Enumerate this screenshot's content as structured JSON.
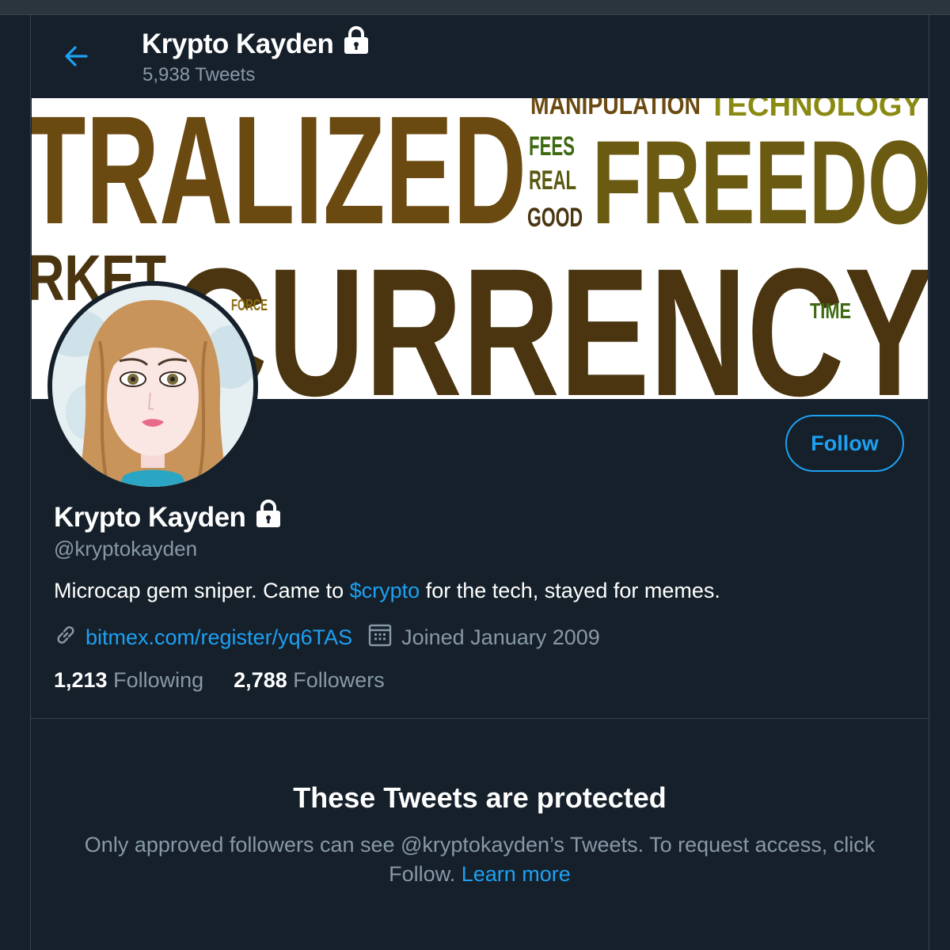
{
  "header": {
    "name": "Krypto Kayden",
    "tweet_count": "5,938 Tweets"
  },
  "banner": {
    "words": [
      "TRALIZED",
      "MANIPULATION",
      "TECHNOLOGY",
      "FEES",
      "REAL",
      "GOOD",
      "FREEDO",
      "RKET",
      "CURRENCY",
      "FORCE",
      "TIME"
    ]
  },
  "profile": {
    "name": "Krypto Kayden",
    "handle": "@kryptokayden",
    "bio_before": "Microcap gem sniper. Came to ",
    "bio_tag": "$crypto",
    "bio_after": " for the tech, stayed for memes.",
    "website": "bitmex.com/register/yq6TAS",
    "joined": "Joined January 2009",
    "following_count": "1,213",
    "following_label": "Following",
    "followers_count": "2,788",
    "followers_label": "Followers"
  },
  "follow_button": "Follow",
  "protected": {
    "title": "These Tweets are protected",
    "text": "Only approved followers can see @kryptokayden’s Tweets. To request access, click Follow.",
    "learn_more": "Learn more"
  },
  "colors": {
    "background": "#15202b",
    "accent": "#1da1f2",
    "secondary_text": "#8899a6",
    "banner_brown": "#4a3510",
    "banner_olive": "#6b5a12"
  },
  "icons": [
    "back-arrow-icon",
    "lock-icon",
    "link-icon",
    "calendar-icon"
  ]
}
